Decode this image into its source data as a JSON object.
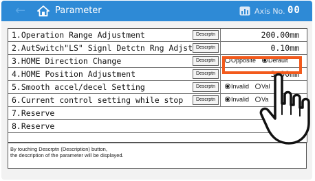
{
  "header": {
    "back_arrow": "←",
    "title": "Parameter",
    "axis_label": "Axis No.",
    "axis_no": "00",
    "color": "#2e8ad6"
  },
  "params": [
    {
      "name": "1.Operation Range Adjustment",
      "desc_label": "Descrptn",
      "value": "200.00mm"
    },
    {
      "name": "2.AutSwitch\"LS\" Signl Detctn Rng Adjst",
      "desc_label": "Descrptn",
      "value": "0.10mm"
    },
    {
      "name": "3.HOME Direction Change",
      "desc_label": "Descrptn",
      "options": [
        "Opposite",
        "Default"
      ],
      "selected": "Default"
    },
    {
      "name": "4.HOME Position Adjustment",
      "desc_label": "Descrptn",
      "value": "3.00mm"
    },
    {
      "name": "5.Smooth accel/decel Setting",
      "desc_label": "Descrptn",
      "options": [
        "Invalid",
        "Val"
      ],
      "selected": "Invalid"
    },
    {
      "name": "6.Current control setting while stop",
      "desc_label": "Descrptn",
      "options": [
        "Invalid",
        "Va"
      ],
      "selected": "Invalid"
    },
    {
      "name": "7.Reserve"
    },
    {
      "name": "8.Reserve"
    }
  ],
  "message": {
    "line1": "By touching Descrptn (Description) button,",
    "line2": "the description of the parameter will be displayed."
  },
  "highlight_color": "#f25a1c"
}
